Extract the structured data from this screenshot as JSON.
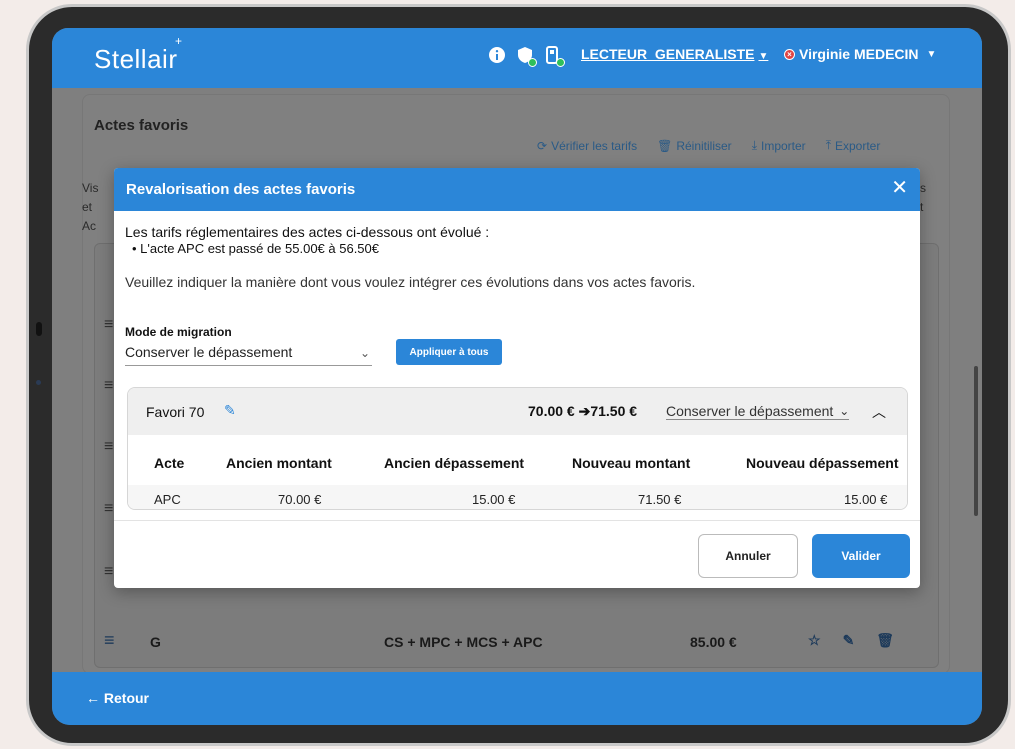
{
  "header": {
    "logo": "Stellair",
    "reader_label": "LECTEUR_GENERALISTE",
    "user_label": "Virginie MEDECIN"
  },
  "background": {
    "title": "Actes favoris",
    "actions": {
      "verify": "Vérifier les tarifs",
      "reset": "Réinitiliser",
      "import": "Importer",
      "export": "Exporter"
    },
    "side_text": [
      "Vis",
      "et",
      "Ac"
    ],
    "right_text": [
      "s",
      "t"
    ],
    "row": {
      "name": "G",
      "code": "CS + MPC + MCS + APC",
      "amount": "85.00 €"
    }
  },
  "modal": {
    "title": "Revalorisation des actes favoris",
    "intro": "Les tarifs réglementaires des actes ci-dessous ont évolué :",
    "bullet": "L'acte APC est passé de 55.00€ à 56.50€",
    "instruction": "Veuillez indiquer la manière dont vous voulez intégrer ces évolutions dans vos actes favoris.",
    "mode_label": "Mode de migration",
    "mode_value": "Conserver le dépassement",
    "apply_label": "Appliquer à tous",
    "favorite": {
      "name": "Favori 70",
      "price_change": "70.00 € ➔71.50 €",
      "mode": "Conserver le dépassement",
      "columns": [
        "Acte",
        "Ancien montant",
        "Ancien dépassement",
        "Nouveau montant",
        "Nouveau dépassement"
      ],
      "rows": [
        [
          "APC",
          "70.00 €",
          "15.00 €",
          "71.50 €",
          "15.00 €"
        ]
      ]
    },
    "cancel_label": "Annuler",
    "validate_label": "Valider"
  },
  "footer": {
    "back_label": "← Retour"
  },
  "colors": {
    "primary": "#2b86d8",
    "overlay": "#7f7f7f",
    "status_ok": "#2fbf5a",
    "status_err": "#e04545"
  }
}
